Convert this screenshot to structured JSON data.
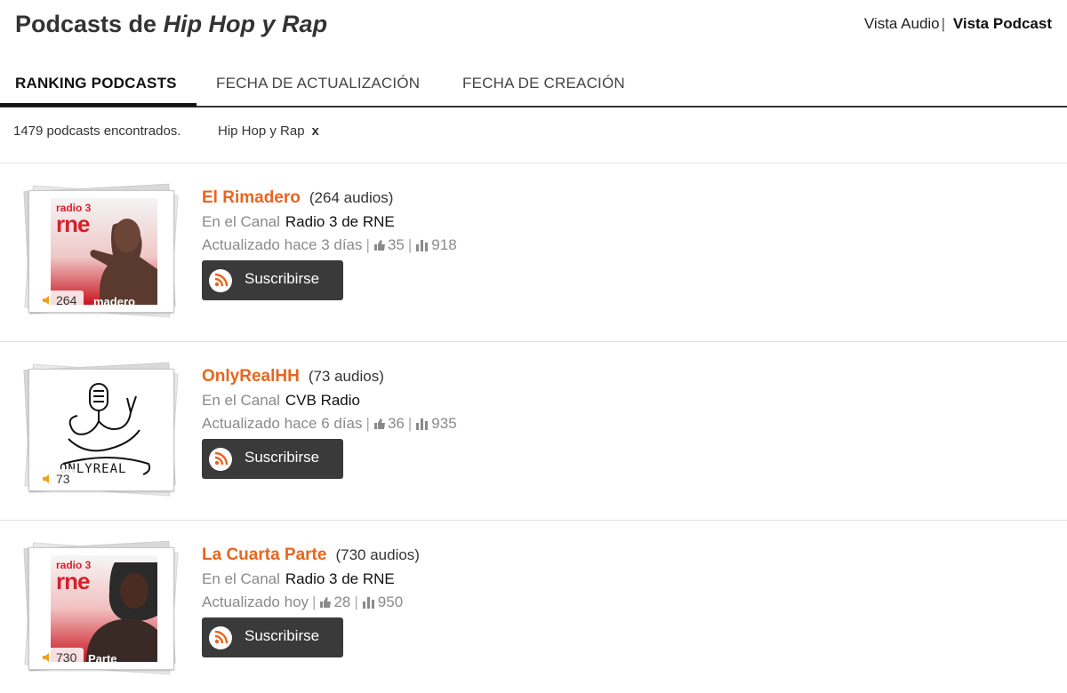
{
  "header": {
    "title_prefix": "Podcasts de ",
    "title_genre": "Hip Hop y Rap",
    "view_audio": "Vista Audio",
    "view_separator": "|",
    "view_podcast": "Vista Podcast"
  },
  "tabs": [
    {
      "label": "RANKING PODCASTS",
      "active": true
    },
    {
      "label": "FECHA DE ACTUALIZACIÓN",
      "active": false
    },
    {
      "label": "FECHA DE CREACIÓN",
      "active": false
    }
  ],
  "filter": {
    "count_text": "1479 podcasts encontrados.",
    "chip_label": "Hip Hop y Rap",
    "chip_remove": "x"
  },
  "labels": {
    "channel_prefix": "En el Canal",
    "subscribe": "Suscribirse",
    "separator": "|"
  },
  "podcasts": [
    {
      "name": "El Rimadero",
      "audio_count": "(264 audios)",
      "channel": "Radio 3 de RNE",
      "updated": "Actualizado hace 3 días",
      "likes": "35",
      "plays": "918",
      "thumb_badge": "264",
      "art_brand_top": "radio 3",
      "art_brand": "rne",
      "art_caption": "madero"
    },
    {
      "name": "OnlyRealHH",
      "audio_count": "(73 audios)",
      "channel": "CVB Radio",
      "updated": "Actualizado hace 6 días",
      "likes": "36",
      "plays": "935",
      "thumb_badge": "73",
      "art_caption": "ONLYREAL"
    },
    {
      "name": "La Cuarta Parte",
      "audio_count": "(730 audios)",
      "channel": "Radio 3 de RNE",
      "updated": "Actualizado hoy",
      "likes": "28",
      "plays": "950",
      "thumb_badge": "730",
      "art_brand_top": "radio 3",
      "art_brand": "rne",
      "art_caption": "Parte"
    }
  ],
  "colors": {
    "accent_orange": "#e8651e",
    "button_dark": "#3a3a3a",
    "rne_red": "#d7202a"
  }
}
